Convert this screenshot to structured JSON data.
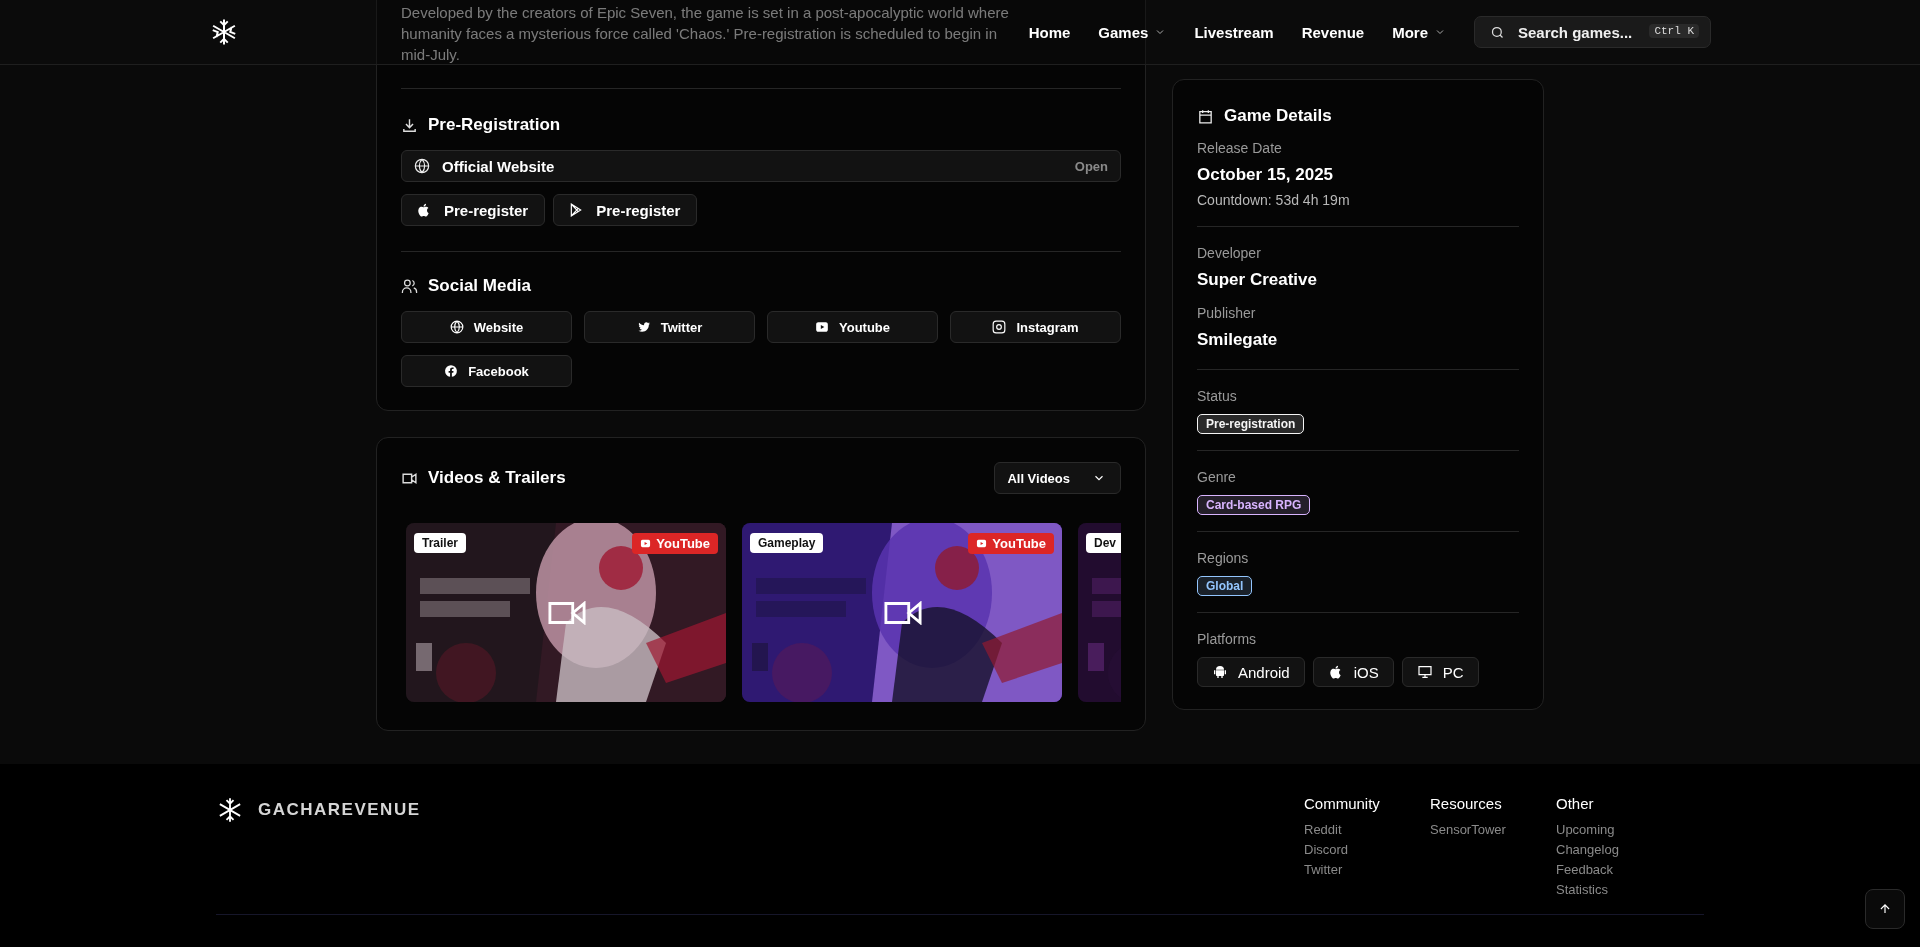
{
  "header": {
    "nav": [
      {
        "label": "Home",
        "dropdown": false
      },
      {
        "label": "Games",
        "dropdown": true
      },
      {
        "label": "Livestream",
        "dropdown": false
      },
      {
        "label": "Revenue",
        "dropdown": false
      },
      {
        "label": "More",
        "dropdown": true
      }
    ],
    "search": {
      "placeholder": "Search games...",
      "shortcut": "Ctrl K"
    }
  },
  "description": "Developed by the creators of Epic Seven, the game is set in a post-apocalyptic world where humanity faces a mysterious force called 'Chaos.' Pre-registration is scheduled to begin in mid-July.",
  "preregistration": {
    "title": "Pre-Registration",
    "website": {
      "label": "Official Website",
      "action": "Open"
    },
    "stores": [
      {
        "kind": "apple",
        "label": "Pre-register"
      },
      {
        "kind": "play",
        "label": "Pre-register"
      }
    ]
  },
  "social": {
    "title": "Social Media",
    "links": [
      {
        "kind": "globe",
        "label": "Website"
      },
      {
        "kind": "twitter",
        "label": "Twitter"
      },
      {
        "kind": "youtube",
        "label": "Youtube"
      },
      {
        "kind": "instagram",
        "label": "Instagram"
      },
      {
        "kind": "facebook",
        "label": "Facebook"
      }
    ]
  },
  "videos": {
    "title": "Videos & Trailers",
    "filter": "All Videos",
    "items": [
      {
        "category": "Trailer",
        "source": "YouTube"
      },
      {
        "category": "Gameplay",
        "source": "YouTube"
      },
      {
        "category": "Dev"
      }
    ]
  },
  "details": {
    "title": "Game Details",
    "sections": [
      {
        "kind": "fields",
        "fields": [
          {
            "label": "Release Date",
            "value": "October 15, 2025",
            "note": "Countdown: 53d 4h 19m"
          }
        ]
      },
      {
        "kind": "fields",
        "fields": [
          {
            "label": "Developer",
            "value": "Super Creative"
          },
          {
            "label": "Publisher",
            "value": "Smilegate"
          }
        ]
      },
      {
        "kind": "tags",
        "label": "Status",
        "tags": [
          {
            "text": "Pre-registration",
            "color": "#f5f5f5"
          }
        ]
      },
      {
        "kind": "tags",
        "label": "Genre",
        "tags": [
          {
            "text": "Card-based RPG",
            "color": "#d8b4fe"
          }
        ]
      },
      {
        "kind": "tags",
        "label": "Regions",
        "tags": [
          {
            "text": "Global",
            "color": "#93c5fd"
          }
        ]
      },
      {
        "kind": "platforms",
        "label": "Platforms",
        "items": [
          {
            "kind": "android",
            "text": "Android"
          },
          {
            "kind": "apple",
            "text": "iOS"
          },
          {
            "kind": "monitor",
            "text": "PC"
          }
        ]
      }
    ]
  },
  "footer": {
    "brand": "GACHAREVENUE",
    "columns": [
      {
        "title": "Community",
        "links": [
          "Reddit",
          "Discord",
          "Twitter"
        ]
      },
      {
        "title": "Resources",
        "links": [
          "SensorTower"
        ]
      },
      {
        "title": "Other",
        "links": [
          "Upcoming",
          "Changelog",
          "Feedback",
          "Statistics"
        ]
      }
    ]
  }
}
